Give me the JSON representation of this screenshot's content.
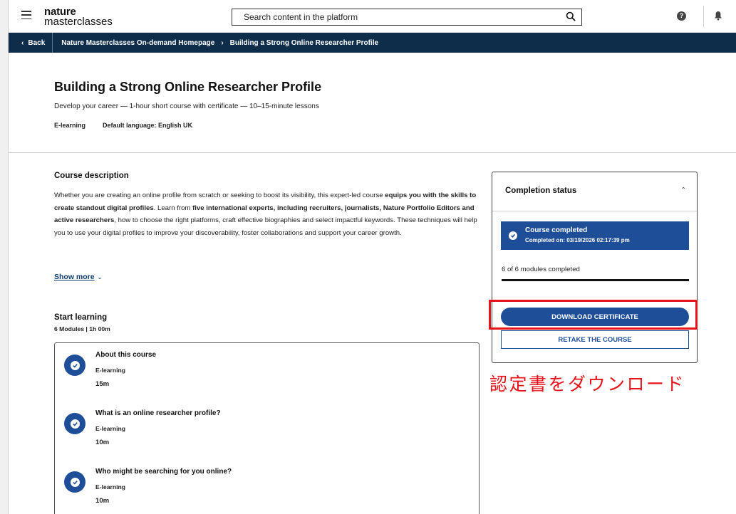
{
  "header": {
    "logo_line1": "nature",
    "logo_line2": "masterclasses",
    "search_placeholder": "Search content in the platform",
    "help_glyph": "?"
  },
  "breadcrumb": {
    "back_label": "Back",
    "items": [
      "Nature Masterclasses On-demand Homepage",
      "Building a Strong Online Researcher Profile"
    ]
  },
  "course": {
    "title": "Building a Strong Online Researcher Profile",
    "subtitle": "Develop your career — 1-hour short course with certificate — 10–15-minute lessons",
    "type": "E-learning",
    "language": "Default language: English UK"
  },
  "description": {
    "heading": "Course description",
    "p1": "Whether you are creating an online profile from scratch or seeking to boost its visibility, this expert-led course ",
    "b1": "equips you with the skills to create standout digital profiles",
    "p2": ". Learn from ",
    "b2": "five international experts, including recruiters, journalists, Nature Portfolio Editors and active researchers",
    "p3": ", how to choose the right platforms, craft effective biographies and select impactful keywords. These techniques will help you to use your digital profiles to improve your discoverability, foster collaborations and support your career growth.",
    "show_more": "Show more"
  },
  "learning": {
    "heading": "Start learning",
    "meta": "6 Modules  |  1h 00m",
    "modules": [
      {
        "title": "About this course",
        "type": "E-learning",
        "duration": "15m"
      },
      {
        "title": "What is an online researcher profile?",
        "type": "E-learning",
        "duration": "10m"
      },
      {
        "title": "Who might be searching for you online?",
        "type": "E-learning",
        "duration": "10m"
      }
    ]
  },
  "completion": {
    "heading": "Completion status",
    "status_title": "Course completed",
    "status_detail": "Completed on: 03/19/2026 02:17:39 pm",
    "modules_completed": "6 of 6 modules completed",
    "progress_fraction": 1.0,
    "download_label": "DOWNLOAD CERTIFICATE",
    "retake_label": "RETAKE THE COURSE"
  },
  "annotation": {
    "text": "認定書をダウンロード",
    "color": "#e8141b"
  },
  "colors": {
    "navy": "#0d2d4a",
    "accent_blue": "#1f4e99"
  },
  "icons": [
    "menu-icon",
    "search-icon",
    "help-icon",
    "bell-icon",
    "chevron-left-icon",
    "chevron-right-icon",
    "chevron-up-icon",
    "chevron-down-icon",
    "check-circle-icon"
  ]
}
